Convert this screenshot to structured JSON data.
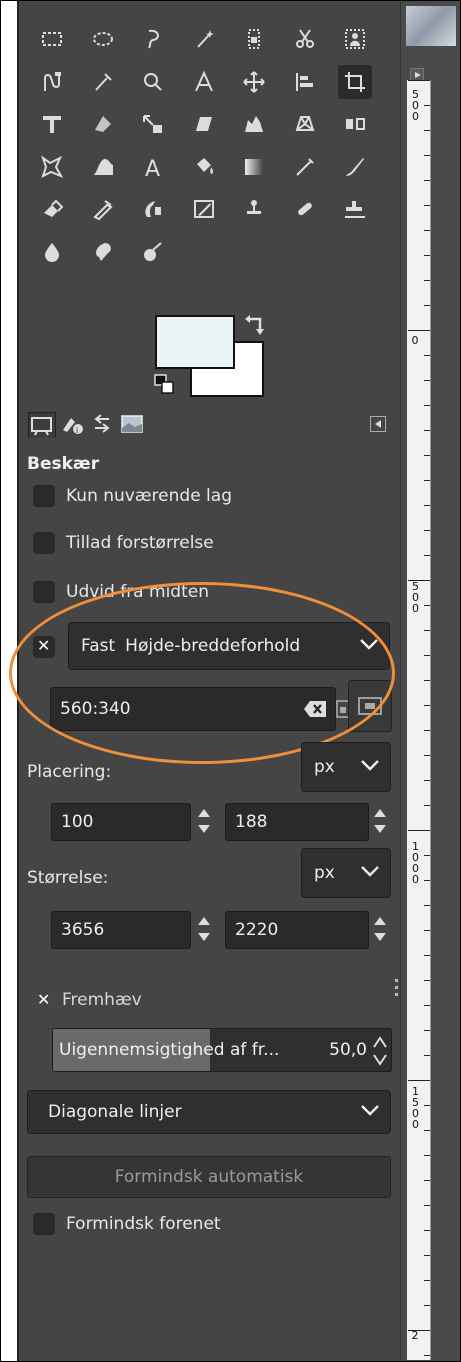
{
  "toolbox": {
    "tools": [
      {
        "icon": "rect-select-icon"
      },
      {
        "icon": "ellipse-select-icon"
      },
      {
        "icon": "free-select-icon"
      },
      {
        "icon": "fuzzy-select-icon"
      },
      {
        "icon": "select-by-color-icon"
      },
      {
        "icon": "scissors-select-icon"
      },
      {
        "icon": "foreground-select-icon"
      },
      {
        "icon": "paths-icon"
      },
      {
        "icon": "color-picker-icon"
      },
      {
        "icon": "zoom-icon"
      },
      {
        "icon": "measure-icon"
      },
      {
        "icon": "move-icon"
      },
      {
        "icon": "align-icon"
      },
      {
        "icon": "crop-icon",
        "active": true
      },
      {
        "icon": "unified-transform-icon"
      },
      {
        "icon": "rotate-icon"
      },
      {
        "icon": "scale-icon"
      },
      {
        "icon": "shear-icon"
      },
      {
        "icon": "warp-transform-icon"
      },
      {
        "icon": "perspective-icon"
      },
      {
        "icon": "flip-icon"
      },
      {
        "icon": "cage-transform-icon"
      },
      {
        "icon": "warp-icon"
      },
      {
        "icon": "text-icon"
      },
      {
        "icon": "bucket-fill-icon"
      },
      {
        "icon": "gradient-icon"
      },
      {
        "icon": "pencil-icon"
      },
      {
        "icon": "paintbrush-icon"
      },
      {
        "icon": "eraser-icon"
      },
      {
        "icon": "airbrush-icon"
      },
      {
        "icon": "ink-icon"
      },
      {
        "icon": "mypaint-brush-icon"
      },
      {
        "icon": "clone-icon"
      },
      {
        "icon": "heal-icon"
      },
      {
        "icon": "perspective-clone-icon"
      },
      {
        "icon": "blur-icon"
      },
      {
        "icon": "smudge-icon"
      },
      {
        "icon": "dodge-burn-icon"
      }
    ],
    "fg_color": "#eaf3f6",
    "bg_color": "#ffffff"
  },
  "dock_tabs": [
    {
      "icon": "tool-options-tab-icon",
      "active": true
    },
    {
      "icon": "device-status-tab-icon"
    },
    {
      "icon": "undo-history-tab-icon"
    },
    {
      "icon": "images-tab-icon"
    }
  ],
  "tool_options": {
    "title": "Beskær",
    "current_layer_only": {
      "label": "Kun nuværende lag",
      "checked": false
    },
    "allow_growing": {
      "label": "Tillad forstørrelse",
      "checked": false
    },
    "expand_from_center": {
      "label": "Udvid fra midten",
      "checked": false
    },
    "fixed": {
      "checked": true,
      "label": "Fast",
      "mode": "Højde-breddeforhold",
      "value": "560:340"
    },
    "position": {
      "label": "Placering:",
      "unit": "px",
      "x": "100",
      "y": "188"
    },
    "size": {
      "label": "Størrelse:",
      "unit": "px",
      "w": "3656",
      "h": "2220"
    },
    "highlight": {
      "label": "Fremhæv",
      "checked": true
    },
    "highlight_opacity": {
      "label": "Uigennemsigtighed af fr...",
      "value": "50,0",
      "fraction": 0.5
    },
    "guides": "Diagonale linjer",
    "auto_shrink_label": "Formindsk automatisk",
    "shrink_merged": {
      "label": "Formindsk forenet",
      "checked": false
    }
  },
  "ruler": {
    "labels": [
      "500",
      "0",
      "500",
      "1000",
      "1500",
      "2"
    ]
  },
  "colors": {
    "highlight_ring": "#ef8f3c",
    "panel": "#454545"
  }
}
